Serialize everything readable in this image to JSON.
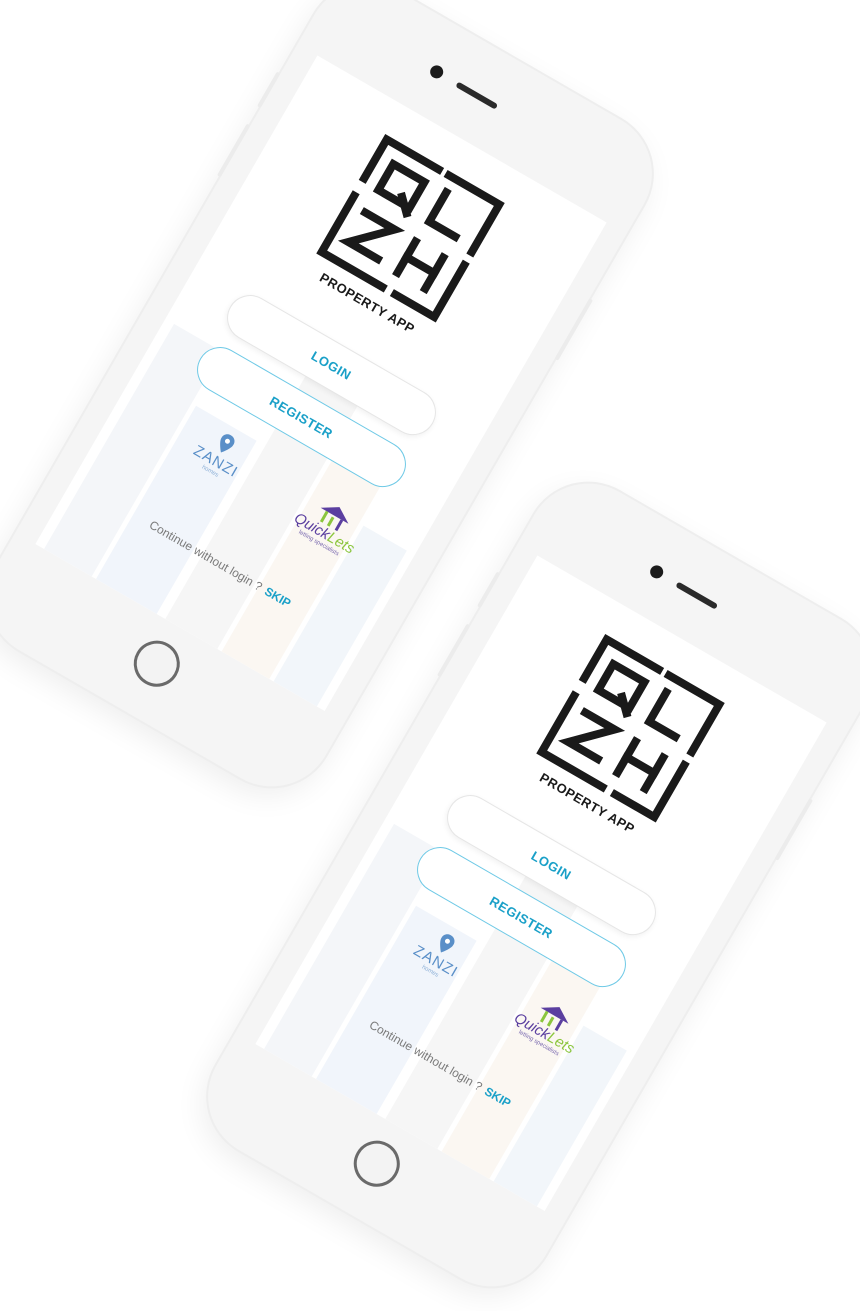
{
  "phones": [
    {
      "logo": {
        "letters": [
          "Q",
          "L",
          "Z",
          "H"
        ],
        "tagline": "PROPERTY APP"
      },
      "buttons": {
        "login": "LOGIN",
        "register": "REGISTER"
      },
      "partners": {
        "zanzi": {
          "name": "ZANZI",
          "sub": "homes"
        },
        "quicklets": {
          "name_a": "Quick",
          "name_b": "Lets",
          "sub": "letting specialists"
        }
      },
      "skip": {
        "text": "Continue without login ?",
        "link": "SKIP"
      }
    },
    {
      "logo": {
        "letters": [
          "Q",
          "L",
          "Z",
          "H"
        ],
        "tagline": "PROPERTY APP"
      },
      "buttons": {
        "login": "LOGIN",
        "register": "REGISTER"
      },
      "partners": {
        "zanzi": {
          "name": "ZANZI",
          "sub": "homes"
        },
        "quicklets": {
          "name_a": "Quick",
          "name_b": "Lets",
          "sub": "letting specialists"
        }
      },
      "skip": {
        "text": "Continue without login ?",
        "link": "SKIP"
      }
    }
  ],
  "colors": {
    "accent": "#1aa0c8",
    "register_border": "#6ec9e6",
    "logo": "#1a1a1a",
    "zanzi": "#5a8fc8",
    "quick_purple": "#5b3fa0",
    "quick_green": "#8cc63e"
  }
}
